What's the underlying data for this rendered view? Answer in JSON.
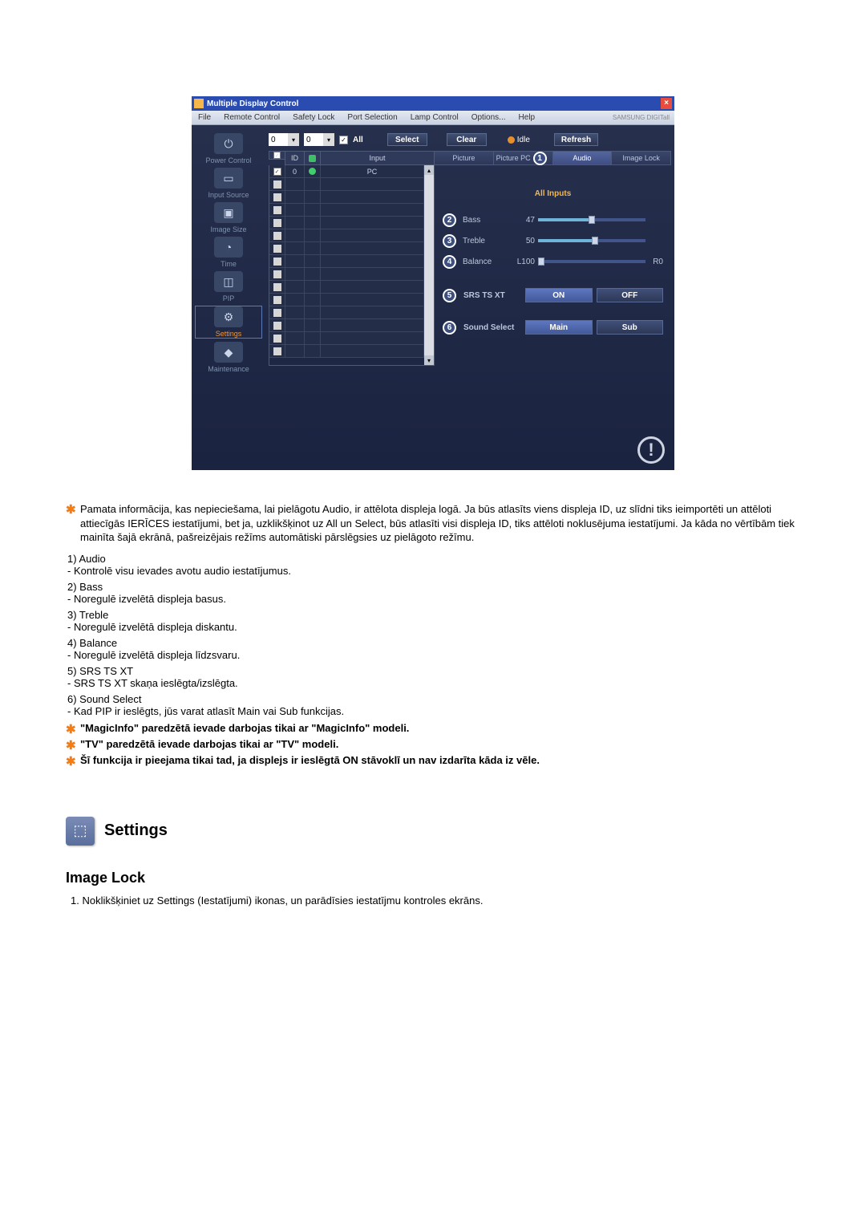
{
  "app": {
    "title": "Multiple Display Control",
    "menu": {
      "file": "File",
      "remote": "Remote Control",
      "safety": "Safety Lock",
      "port": "Port Selection",
      "lamp": "Lamp Control",
      "options": "Options...",
      "help": "Help",
      "brand": "SAMSUNG DIGITall"
    },
    "sidebar": {
      "power": "Power Control",
      "input": "Input Source",
      "image": "Image Size",
      "time": "Time",
      "pip": "PIP",
      "settings": "Settings",
      "maintenance": "Maintenance"
    },
    "toolbar": {
      "spin1": "0",
      "spin2": "0",
      "all": "All",
      "select": "Select",
      "clear": "Clear",
      "idle": "Idle",
      "refresh": "Refresh"
    },
    "gridhead": {
      "id": "ID",
      "input": "Input"
    },
    "gridrow0": {
      "id": "0",
      "input": "PC"
    },
    "tabs": {
      "picture": "Picture",
      "picturepc": "Picture PC",
      "audio": "Audio",
      "imagelock": "Image Lock"
    },
    "right": {
      "allinputs": "All Inputs",
      "bass": "Bass",
      "bass_v": "47",
      "treble": "Treble",
      "treble_v": "50",
      "balance": "Balance",
      "balance_v": "L100",
      "balance_r": "R0",
      "srs": "SRS TS XT",
      "on": "ON",
      "off": "OFF",
      "sound": "Sound Select",
      "main": "Main",
      "sub": "Sub"
    }
  },
  "doc": {
    "intro": "Pamata informācija, kas nepieciešama, lai pielāgotu Audio, ir attēlota displeja logā. Ja būs atlasīts viens displeja ID, uz slīdni tiks ieimportēti un attēloti attiecīgās IERĪCES iestatījumi, bet ja, uzklikšķinot uz All un Select, būs atlasīti visi displeja ID, tiks attēloti noklusējuma iestatījumi. Ja kāda no vērtībām tiek mainīta šajā ekrānā, pašreizējais režīms automātiski pārslēgsies uz pielāgoto režīmu.",
    "i1h": "1)  Audio",
    "i1d": " - Kontrolē visu ievades avotu audio iestatījumus.",
    "i2h": "2)  Bass",
    "i2d": " - Noregulē izvelētā displeja basus.",
    "i3h": "3)  Treble",
    "i3d": " - Noregulē izvelētā displeja diskantu.",
    "i4h": "4)  Balance",
    "i4d": " - Noregulē izvelētā displeja līdzsvaru.",
    "i5h": "5)  SRS TS XT",
    "i5d": " - SRS TS XT skaņa ieslēgta/izslēgta.",
    "i6h": "6)  Sound Select",
    "i6d": " - Kad PIP ir ieslēgts, jūs varat atlasīt Main vai Sub funkcijas.",
    "s1": "\"MagicInfo\" paredzētā ievade darbojas tikai ar \"MagicInfo\" modeli.",
    "s2": "\"TV\" paredzētā ievade darbojas tikai ar \"TV\" modeli.",
    "s3": "Šī funkcija ir pieejama tikai tad, ja displejs ir ieslēgtā ON stāvoklī un nav izdarīta kāda iz vēle.",
    "hsettings": "Settings",
    "himagelock": "Image Lock",
    "step1": "1.  Noklikšķiniet uz Settings (Iestatījumi) ikonas, un parādīsies iestatījmu kontroles ekrāns."
  }
}
